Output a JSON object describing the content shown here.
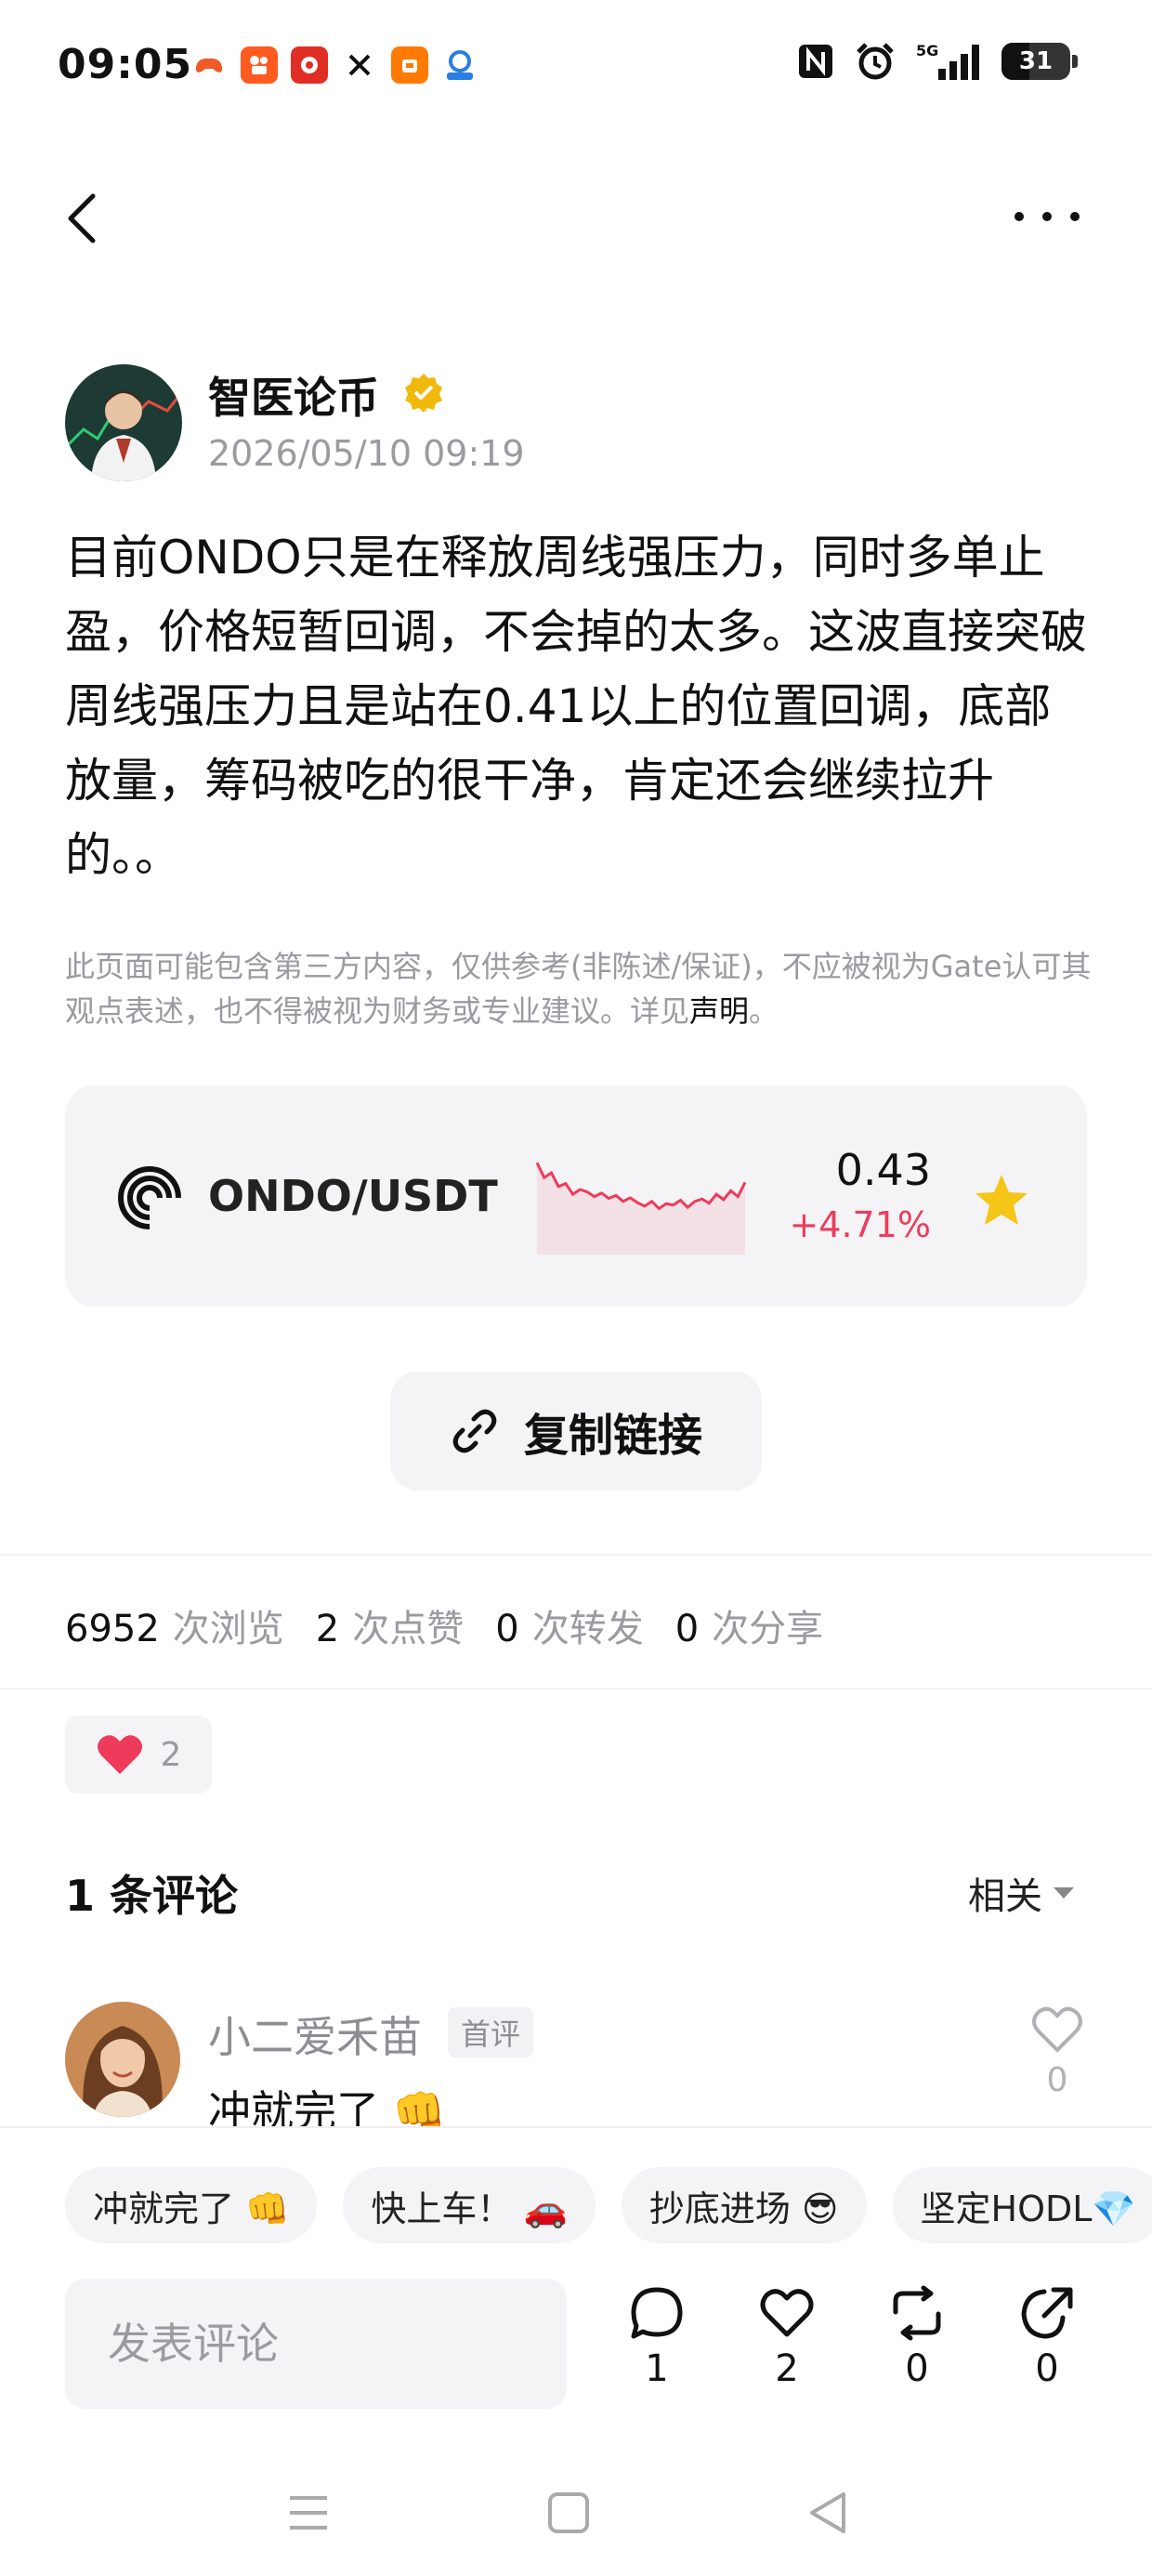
{
  "status_bar": {
    "time": "09:05",
    "network": "5G",
    "battery": "31",
    "app_icons": [
      "game-controller-icon",
      "kuaishou-icon",
      "pinduoduo-icon",
      "x-icon",
      "taobao-icon",
      "bank-app-icon"
    ]
  },
  "nav": {
    "back_icon": "chevron-left-icon",
    "more_icon": "ellipsis-icon"
  },
  "post": {
    "author": "智医论币",
    "timestamp": "2026/05/10 09:19",
    "content": "目前ONDO只是在释放周线强压力，同时多单止盈，价格短暂回调，不会掉的太多。这波直接突破周线强压力且是站在0.41以上的位置回调，底部放量，筹码被吃的很干净，肯定还会继续拉升的。。",
    "disclaimer": "此页面可能包含第三方内容，仅供参考(非陈述/保证)，不应被视为Gate认可其观点表述，也不得被视为财务或专业建议。详见",
    "disclaimer_link": "声明",
    "disclaimer_end": "。"
  },
  "ticker": {
    "symbol": "ONDO/USDT",
    "price": "0.43",
    "change": "+4.71%",
    "change_color": "#ee3b5b",
    "sparkline": [
      0.95,
      0.7,
      0.78,
      0.55,
      0.6,
      0.42,
      0.5,
      0.46,
      0.38,
      0.44,
      0.35,
      0.4,
      0.3,
      0.36,
      0.28,
      0.22,
      0.3,
      0.18,
      0.26,
      0.24,
      0.32,
      0.2,
      0.3,
      0.34,
      0.27,
      0.42,
      0.33,
      0.48,
      0.38,
      0.62
    ]
  },
  "copy_link": {
    "label": "复制链接"
  },
  "stats": {
    "views": "6952",
    "views_label": "次浏览",
    "likes": "2",
    "likes_label": "次点赞",
    "reposts": "0",
    "reposts_label": "次转发",
    "shares": "0",
    "shares_label": "次分享"
  },
  "reaction": {
    "count": "2"
  },
  "comments": {
    "title": "1 条评论",
    "sort": "相关",
    "items": [
      {
        "user": "小二爱禾苗",
        "badge": "首评",
        "text": "冲就完了 👊",
        "likes": "0"
      }
    ]
  },
  "quick_replies": [
    "冲就完了 👊",
    "快上车！ 🚗",
    "抄底进场 😎",
    "坚定HODL💎"
  ],
  "composer": {
    "placeholder": "发表评论"
  },
  "actions": {
    "comments": "1",
    "likes": "2",
    "reposts": "0",
    "shares": "0"
  },
  "colors": {
    "accent_red": "#ee3b5b",
    "star_yellow": "#f5c518",
    "verified_gold": "#f0b90b"
  }
}
